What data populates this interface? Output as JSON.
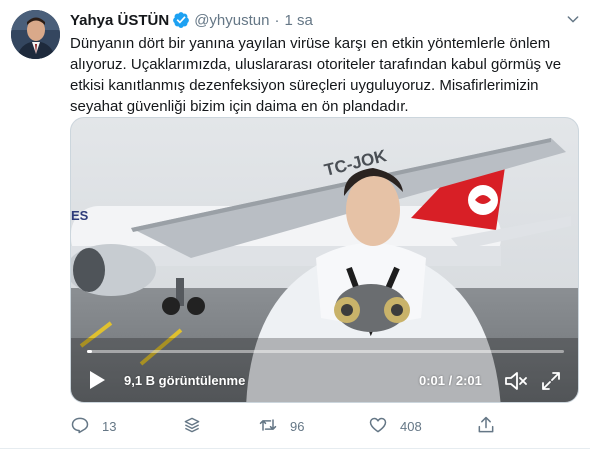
{
  "tweet": {
    "author_name": "Yahya ÜSTÜN",
    "handle": "@yhyustun",
    "separator": "·",
    "time": "1 sa",
    "text_lines": [
      "Dünyanın dört bir yanına yayılan virüse karşı en etkin yöntemlerle önlem",
      "alıyoruz. Uçaklarımızda, uluslararası otoriteler tarafından kabul görmüş ve",
      "etkisi kanıtlanmış dezenfeksiyon süreçleri uyguluyoruz. Misafirlerimizin",
      "seyahat güvenliği bizim için daima en ön plandadır."
    ]
  },
  "video": {
    "views": "9,1 B görüntülenme",
    "duration": "0:01 / 2:01",
    "progress": 0.01,
    "aircraft_registration": "TC-JOK",
    "livery_text": "ES"
  },
  "actions": {
    "reply_count": "13",
    "retweet_count": "96",
    "like_count": "408"
  },
  "colors": {
    "verified": "#1da1f2",
    "secondary_text": "#657786",
    "tail_red": "#d81f26"
  },
  "icons": [
    "verified-badge-icon",
    "chevron-down-icon",
    "play-icon",
    "volume-icon",
    "fullscreen-icon",
    "reply-icon",
    "message-stack-icon",
    "retweet-icon",
    "like-icon",
    "share-icon"
  ]
}
